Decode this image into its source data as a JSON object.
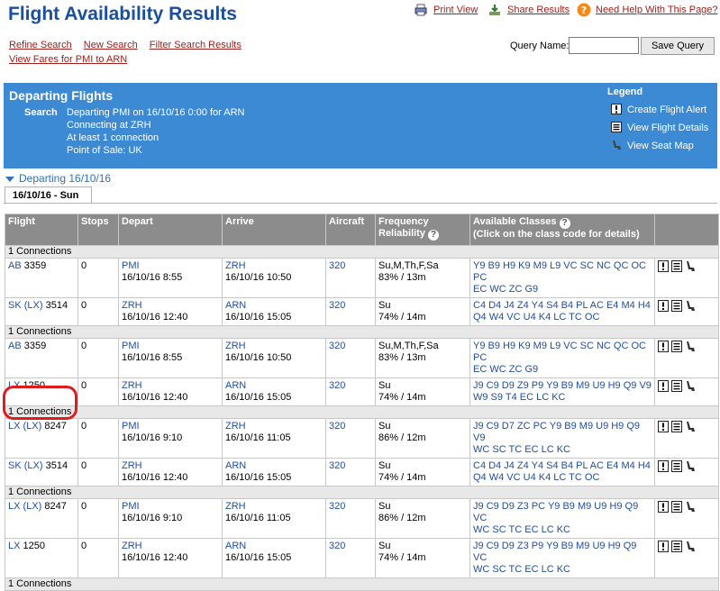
{
  "header": {
    "title": "Flight Availability Results",
    "print_view": "Print View",
    "share_results": "Share Results",
    "help": "Need Help With This Page?"
  },
  "nav": {
    "refine": "Refine Search",
    "new": "New Search",
    "filter": "Filter Search Results",
    "view_fares": "View Fares for PMI to ARN"
  },
  "query": {
    "label": "Query Name:",
    "value": "",
    "save": "Save Query"
  },
  "band": {
    "title": "Departing Flights",
    "search_label": "Search",
    "lines": [
      "Departing PMI on 16/10/16 0:00 for ARN",
      "Connecting at ZRH",
      "At least 1 connection",
      "Point of Sale: UK"
    ],
    "legend_title": "Legend",
    "legend": [
      "Create Flight Alert",
      "View Flight Details",
      "View Seat Map"
    ]
  },
  "departing_head": "Departing 16/10/16",
  "tab": "16/10/16 - Sun",
  "columns": [
    "Flight",
    "Stops",
    "Depart",
    "Arrive",
    "Aircraft",
    "Frequency",
    "Reliability",
    "Available Classes",
    "(Click on the class code for details)"
  ],
  "conn_label": "1 Connections",
  "groups": [
    [
      {
        "carrier": "AB",
        "op": "",
        "num": "3359",
        "stops": "0",
        "dep_ap": "PMI",
        "dep_t": "16/10/16 8:55",
        "arr_ap": "ZRH",
        "arr_t": "16/10/16 10:50",
        "ac": "320",
        "freq": "Su,M,Th,F,Sa",
        "rel": "83% / 13m",
        "cls1": "Y9 B9 H9 K9 M9 L9 VC SC NC QC OC PC",
        "cls2": "EC WC ZC G9"
      },
      {
        "carrier": "SK",
        "op": "(LX)",
        "num": "3514",
        "stops": "0",
        "dep_ap": "ZRH",
        "dep_t": "16/10/16 12:40",
        "arr_ap": "ARN",
        "arr_t": "16/10/16 15:05",
        "ac": "320",
        "freq": "Su",
        "rel": "74% / 14m",
        "cls1": "C4 D4 J4 Z4 Y4 S4 B4 PL AC E4 M4 H4",
        "cls2": "Q4 W4 VC U4 K4 LC TC OC"
      }
    ],
    [
      {
        "carrier": "AB",
        "op": "",
        "num": "3359",
        "stops": "0",
        "dep_ap": "PMI",
        "dep_t": "16/10/16 8:55",
        "arr_ap": "ZRH",
        "arr_t": "16/10/16 10:50",
        "ac": "320",
        "freq": "Su,M,Th,F,Sa",
        "rel": "83% / 13m",
        "cls1": "Y9 B9 H9 K9 M9 L9 VC SC NC QC OC PC",
        "cls2": "EC WC ZC G9"
      },
      {
        "carrier": "LX",
        "op": "",
        "num": "1250",
        "stops": "0",
        "dep_ap": "ZRH",
        "dep_t": "16/10/16 12:40",
        "arr_ap": "ARN",
        "arr_t": "16/10/16 15:05",
        "ac": "320",
        "freq": "Su",
        "rel": "74% / 14m",
        "cls1": "J9 C9 D9 Z9 P9 Y9 B9 M9 U9 H9 Q9 V9",
        "cls2": "W9 S9 T4 EC LC KC"
      }
    ],
    [
      {
        "carrier": "LX",
        "op": "(LX)",
        "num": "8247",
        "stops": "0",
        "dep_ap": "PMI",
        "dep_t": "16/10/16 9:10",
        "arr_ap": "ZRH",
        "arr_t": "16/10/16 11:05",
        "ac": "320",
        "freq": "Su",
        "rel": "86% / 12m",
        "cls1": "J9 C9 D7 ZC PC Y9 B9 M9 U9 H9 Q9 V9",
        "cls2": "WC SC TC EC LC KC"
      },
      {
        "carrier": "SK",
        "op": "(LX)",
        "num": "3514",
        "stops": "0",
        "dep_ap": "ZRH",
        "dep_t": "16/10/16 12:40",
        "arr_ap": "ARN",
        "arr_t": "16/10/16 15:05",
        "ac": "320",
        "freq": "Su",
        "rel": "74% / 14m",
        "cls1": "C4 D4 J4 Z4 Y4 S4 B4 PL AC E4 M4 H4",
        "cls2": "Q4 W4 VC U4 K4 LC TC OC"
      }
    ],
    [
      {
        "carrier": "LX",
        "op": "(LX)",
        "num": "8247",
        "stops": "0",
        "dep_ap": "PMI",
        "dep_t": "16/10/16 9:10",
        "arr_ap": "ZRH",
        "arr_t": "16/10/16 11:05",
        "ac": "320",
        "freq": "Su",
        "rel": "86% / 12m",
        "cls1": "J9 C9 D9 Z3 PC Y9 B9 M9 U9 H9 Q9 VC",
        "cls2": "WC SC TC EC LC KC"
      },
      {
        "carrier": "LX",
        "op": "",
        "num": "1250",
        "stops": "0",
        "dep_ap": "ZRH",
        "dep_t": "16/10/16 12:40",
        "arr_ap": "ARN",
        "arr_t": "16/10/16 15:05",
        "ac": "320",
        "freq": "Su",
        "rel": "74% / 14m",
        "cls1": "J9 C9 D9 Z3 P9 Y9 B9 M9 U9 H9 Q9 VC",
        "cls2": "WC SC TC EC LC KC"
      }
    ],
    []
  ],
  "colors": {
    "brand": "#1a4f9e",
    "band": "#3c8ad4",
    "link_red": "#a0201c",
    "highlight": "#e01b1b"
  }
}
